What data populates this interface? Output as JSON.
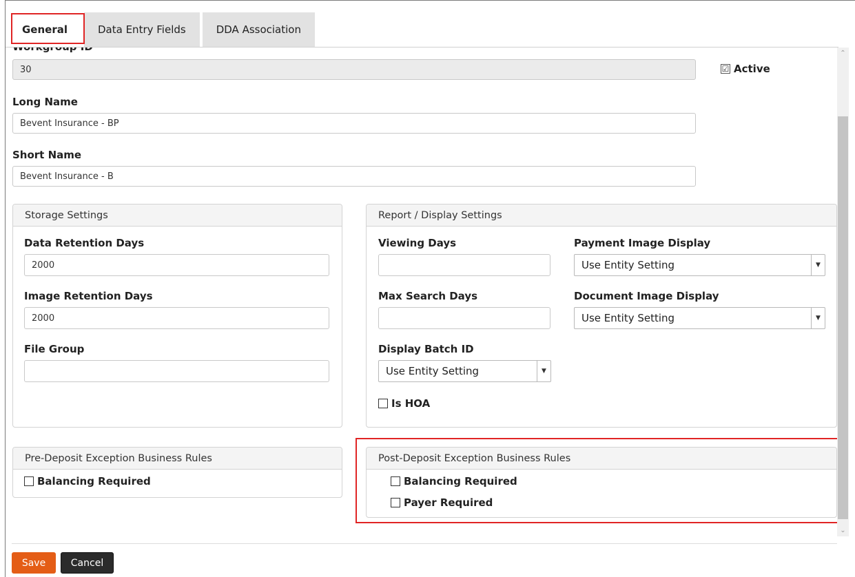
{
  "tabs": [
    {
      "label": "General",
      "active": true
    },
    {
      "label": "Data Entry Fields",
      "active": false
    },
    {
      "label": "DDA Association",
      "active": false
    }
  ],
  "general": {
    "workgroup_id_label": "Workgroup ID",
    "workgroup_id_value": "30",
    "active_label": "Active",
    "active_checked": true,
    "long_name_label": "Long Name",
    "long_name_value": "Bevent Insurance - BP",
    "short_name_label": "Short Name",
    "short_name_value": "Bevent Insurance - B"
  },
  "storage": {
    "title": "Storage Settings",
    "data_retention_label": "Data Retention Days",
    "data_retention_value": "2000",
    "image_retention_label": "Image Retention Days",
    "image_retention_value": "2000",
    "file_group_label": "File Group",
    "file_group_value": ""
  },
  "report": {
    "title": "Report / Display Settings",
    "viewing_days_label": "Viewing Days",
    "viewing_days_value": "",
    "max_search_label": "Max Search Days",
    "max_search_value": "",
    "display_batch_label": "Display Batch ID",
    "display_batch_value": "Use Entity Setting",
    "is_hoa_label": "Is HOA",
    "payment_image_label": "Payment Image Display",
    "payment_image_value": "Use Entity Setting",
    "document_image_label": "Document Image Display",
    "document_image_value": "Use Entity Setting"
  },
  "pre_deposit": {
    "title": "Pre-Deposit Exception Business Rules",
    "balancing_label": "Balancing Required"
  },
  "post_deposit": {
    "title": "Post-Deposit Exception Business Rules",
    "balancing_label": "Balancing Required",
    "payer_label": "Payer Required"
  },
  "footer": {
    "save_label": "Save",
    "cancel_label": "Cancel"
  },
  "colors": {
    "accent_highlight": "#e02424",
    "save_button": "#e45d16",
    "cancel_button": "#2b2b2b"
  },
  "icons": {
    "checkbox_checked": "☑",
    "checkbox_unchecked": "☐",
    "dropdown": "▼",
    "scroll_up": "⌃",
    "scroll_down": "⌄"
  }
}
